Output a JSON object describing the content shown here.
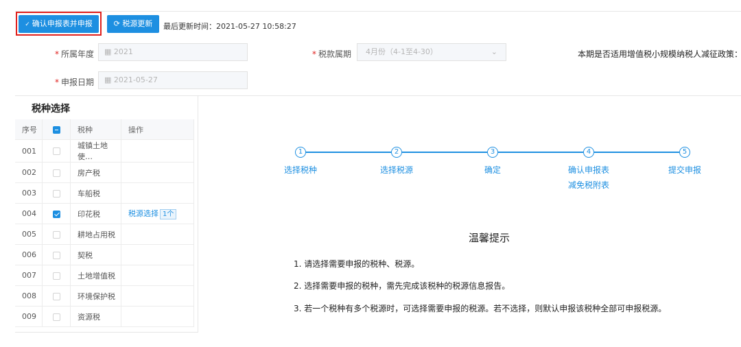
{
  "toolbar": {
    "confirm_label": "确认申报表并申报",
    "refresh_label": "税源更新",
    "update_time": "最后更新时间：2021-05-27 10:58:27"
  },
  "form": {
    "year_label": "所属年度",
    "year_value": "2021",
    "period_label": "税款属期",
    "period_value": "4月份（4-1至4-30）",
    "date_label": "申报日期",
    "date_value": "2021-05-27",
    "policy_text": "本期是否适用增值税小规模纳税人减征政策：否"
  },
  "tax_select": {
    "title": "税种选择",
    "headers": {
      "no": "序号",
      "tax": "税种",
      "op": "操作"
    },
    "rows": [
      {
        "no": "001",
        "tax": "城镇土地使…",
        "checked": false
      },
      {
        "no": "002",
        "tax": "房产税",
        "checked": false
      },
      {
        "no": "003",
        "tax": "车船税",
        "checked": false
      },
      {
        "no": "004",
        "tax": "印花税",
        "checked": true,
        "op": "税源选择",
        "badge": "1个"
      },
      {
        "no": "005",
        "tax": "耕地占用税",
        "checked": false
      },
      {
        "no": "006",
        "tax": "契税",
        "checked": false
      },
      {
        "no": "007",
        "tax": "土地增值税",
        "checked": false
      },
      {
        "no": "008",
        "tax": "环境保护税",
        "checked": false
      },
      {
        "no": "009",
        "tax": "资源税",
        "checked": false
      }
    ]
  },
  "steps": [
    {
      "num": "1",
      "label": "选择税种"
    },
    {
      "num": "2",
      "label": "选择税源"
    },
    {
      "num": "3",
      "label": "确定"
    },
    {
      "num": "4",
      "label": "确认申报表",
      "sub": "减免税附表"
    },
    {
      "num": "5",
      "label": "提交申报"
    }
  ],
  "tips": {
    "title": "温馨提示",
    "items": [
      "1. 请选择需要申报的税种、税源。",
      "2. 选择需要申报的税种，需先完成该税种的税源信息报告。",
      "3. 若一个税种有多个税源时，可选择需要申报的税源。若不选择，则默认申报该税种全部可申报税源。"
    ]
  },
  "colors": {
    "primary": "#1d8fe1",
    "highlight": "#e0201d"
  }
}
